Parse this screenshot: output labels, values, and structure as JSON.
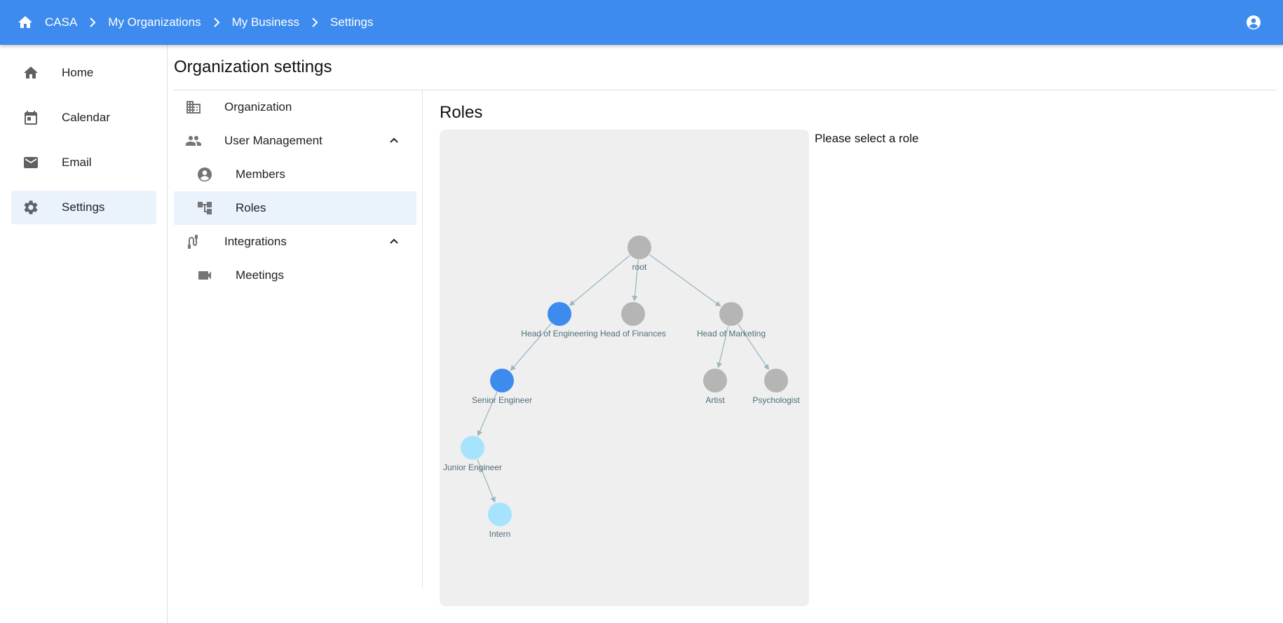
{
  "breadcrumb": {
    "items": [
      "CASA",
      "My Organizations",
      "My Business",
      "Settings"
    ]
  },
  "sidebar": {
    "items": [
      {
        "label": "Home",
        "icon": "home-icon"
      },
      {
        "label": "Calendar",
        "icon": "calendar-icon"
      },
      {
        "label": "Email",
        "icon": "email-icon"
      },
      {
        "label": "Settings",
        "icon": "gear-icon",
        "active": true
      }
    ]
  },
  "page": {
    "title": "Organization settings"
  },
  "settings_nav": {
    "organization": "Organization",
    "user_management": "User Management",
    "members": "Members",
    "roles": "Roles",
    "integrations": "Integrations",
    "meetings": "Meetings"
  },
  "roles": {
    "title": "Roles",
    "empty_message": "Please select a role",
    "nodes": [
      {
        "id": "root",
        "label": "root",
        "status": "default"
      },
      {
        "id": "eng",
        "label": "Head of Engineering",
        "status": "highlighted"
      },
      {
        "id": "fin",
        "label": "Head of Finances",
        "status": "default"
      },
      {
        "id": "mkt",
        "label": "Head of Marketing",
        "status": "default"
      },
      {
        "id": "sen",
        "label": "Senior Engineer",
        "status": "highlighted"
      },
      {
        "id": "art",
        "label": "Artist",
        "status": "default"
      },
      {
        "id": "psy",
        "label": "Psychologist",
        "status": "default"
      },
      {
        "id": "jun",
        "label": "Junior Engineer",
        "status": "descendant"
      },
      {
        "id": "int",
        "label": "Intern",
        "status": "descendant"
      }
    ],
    "edges": [
      [
        "root",
        "eng"
      ],
      [
        "root",
        "fin"
      ],
      [
        "root",
        "mkt"
      ],
      [
        "eng",
        "sen"
      ],
      [
        "mkt",
        "art"
      ],
      [
        "mkt",
        "psy"
      ],
      [
        "sen",
        "jun"
      ],
      [
        "jun",
        "int"
      ]
    ]
  },
  "colors": {
    "header": "#3d8bee",
    "node_default": "#b5b5b5",
    "node_highlighted": "#3d8bee",
    "node_descendant": "#a6e4fd",
    "edge": "#9fb6c1",
    "active_bg": "#eaf2fc"
  }
}
